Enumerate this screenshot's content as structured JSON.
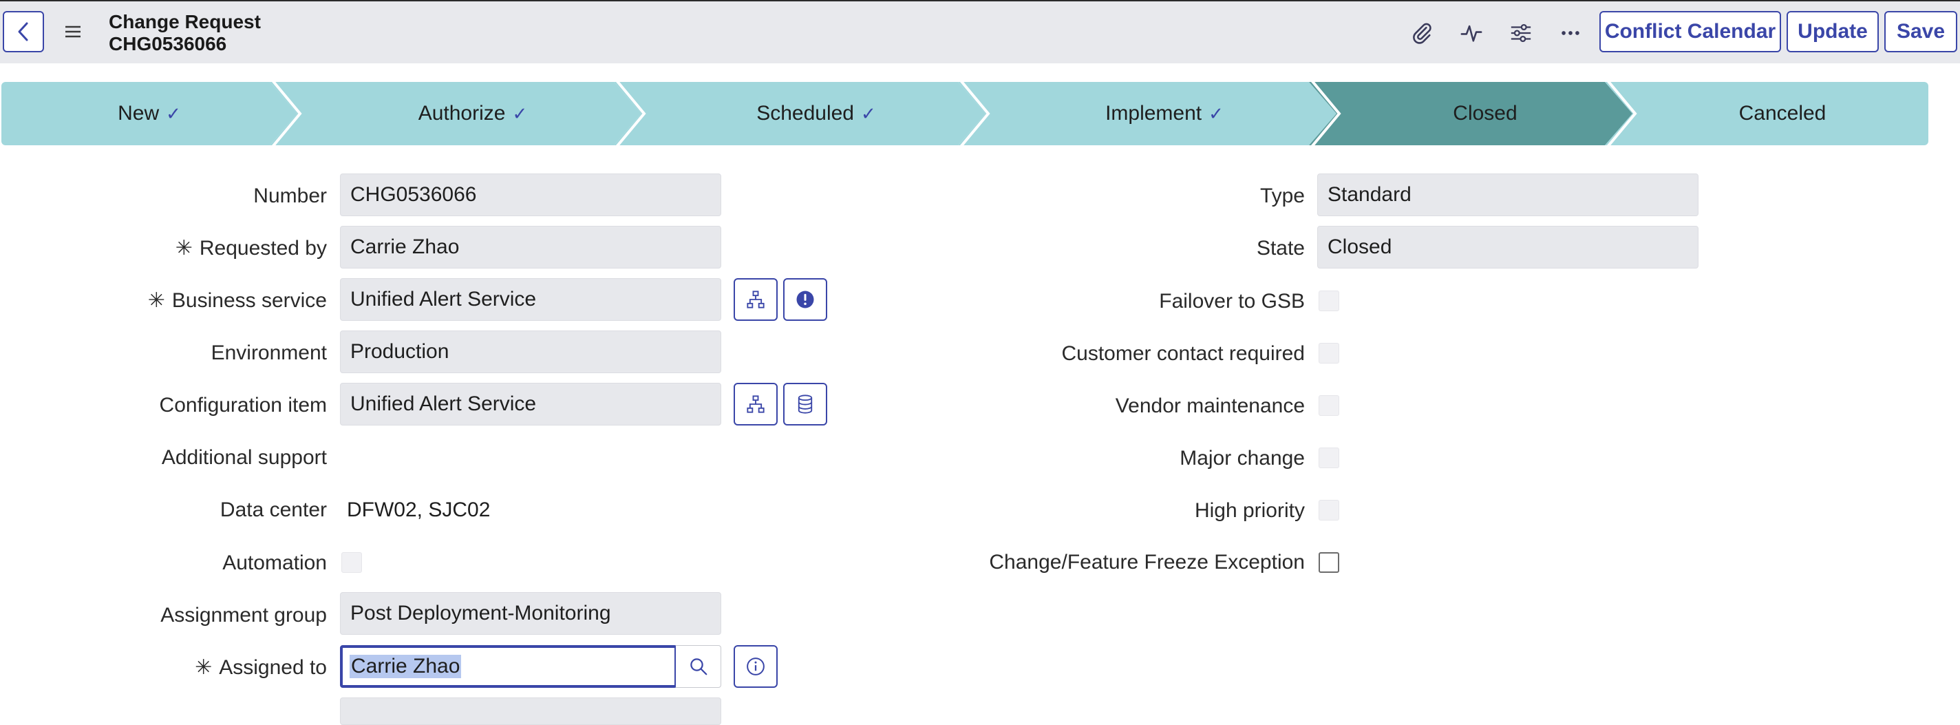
{
  "header": {
    "title": "Change Request",
    "number": "CHG0536066",
    "buttons": {
      "conflict_calendar": "Conflict Calendar",
      "update": "Update",
      "save": "Save"
    },
    "icons": [
      "back-icon",
      "hamburger-menu-icon",
      "paperclip-icon",
      "activity-icon",
      "settings-sliders-icon",
      "more-icon"
    ]
  },
  "process_flow": {
    "stages": [
      {
        "label": "New",
        "done": true
      },
      {
        "label": "Authorize",
        "done": true
      },
      {
        "label": "Scheduled",
        "done": true
      },
      {
        "label": "Implement",
        "done": true
      },
      {
        "label": "Closed",
        "done": false,
        "current": true
      },
      {
        "label": "Canceled",
        "done": false
      }
    ],
    "colors": {
      "default": "#a1d7dc",
      "current": "#5a9a9a",
      "divider": "#ffffff"
    },
    "check_glyph": "✓"
  },
  "form": {
    "required_glyph": "✳",
    "left": {
      "number": {
        "label": "Number",
        "value": "CHG0536066"
      },
      "requested_by": {
        "label": "Requested by",
        "value": "Carrie Zhao",
        "required": true
      },
      "business_service": {
        "label": "Business service",
        "value": "Unified Alert Service",
        "required": true
      },
      "environment": {
        "label": "Environment",
        "value": "Production"
      },
      "configuration_item": {
        "label": "Configuration item",
        "value": "Unified Alert Service"
      },
      "additional_support": {
        "label": "Additional support",
        "value": ""
      },
      "data_center": {
        "label": "Data center",
        "value": "DFW02, SJC02"
      },
      "automation": {
        "label": "Automation",
        "checked": false
      },
      "assignment_group": {
        "label": "Assignment group",
        "value": "Post Deployment-Monitoring"
      },
      "assigned_to": {
        "label": "Assigned to",
        "value": "Carrie Zhao",
        "required": true
      }
    },
    "right": {
      "type": {
        "label": "Type",
        "value": "Standard"
      },
      "state": {
        "label": "State",
        "value": "Closed"
      },
      "failover_to_gsb": {
        "label": "Failover to GSB",
        "checked": false
      },
      "customer_contact_required": {
        "label": "Customer contact required",
        "checked": false
      },
      "vendor_maintenance": {
        "label": "Vendor maintenance",
        "checked": false
      },
      "major_change": {
        "label": "Major change",
        "checked": false
      },
      "high_priority": {
        "label": "High priority",
        "checked": false
      },
      "freeze_exception": {
        "label": "Change/Feature Freeze Exception",
        "checked": false
      }
    }
  },
  "colors": {
    "accent": "#3a46a8",
    "header_bg": "#e8e9ed",
    "field_bg": "#e7e8ec"
  }
}
